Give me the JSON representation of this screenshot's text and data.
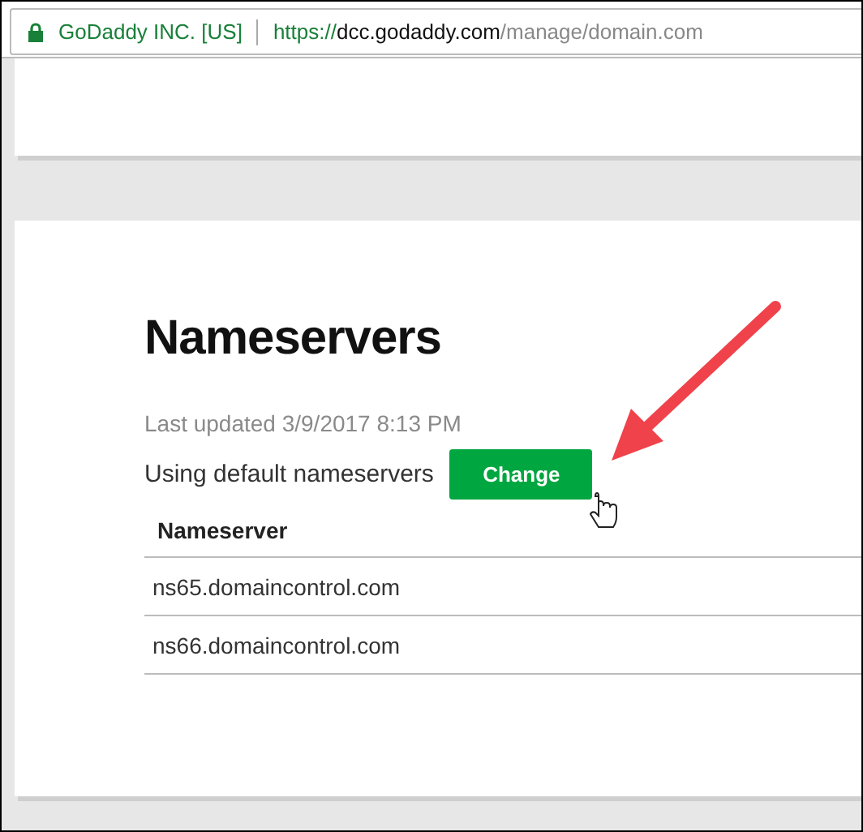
{
  "address_bar": {
    "site_identity": "GoDaddy INC. [US]",
    "url": {
      "scheme": "https://",
      "host": "dcc.godaddy.com",
      "path": "/manage/domain.com"
    }
  },
  "nameservers_card": {
    "title": "Nameservers",
    "last_updated": "Last updated 3/9/2017 8:13 PM",
    "status": "Using default nameservers",
    "button": "Change",
    "table": {
      "columns": [
        "Nameserver"
      ],
      "rows": [
        [
          "ns65.domaincontrol.com"
        ],
        [
          "ns66.domaincontrol.com"
        ]
      ]
    }
  }
}
